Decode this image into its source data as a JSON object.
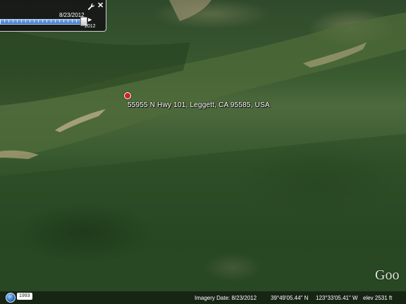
{
  "map": {
    "address_label": "55955 N Hwy 101, Leggett, CA 95585, USA"
  },
  "time_slider": {
    "date": "8/23/2012",
    "year": "2012",
    "play_symbol": "▶",
    "close_symbol": "✕"
  },
  "status_bar": {
    "start_year": "1993",
    "imagery_date": "Imagery Date: 8/23/2012",
    "latitude": "39°49'05.44\" N",
    "longitude": "123°33'05.41\" W",
    "elevation": "elev  2531 ft"
  },
  "brand": {
    "logo_text": "Goo"
  },
  "colors": {
    "marker": "#d8201a",
    "slider_blue": "#3e73c8"
  }
}
